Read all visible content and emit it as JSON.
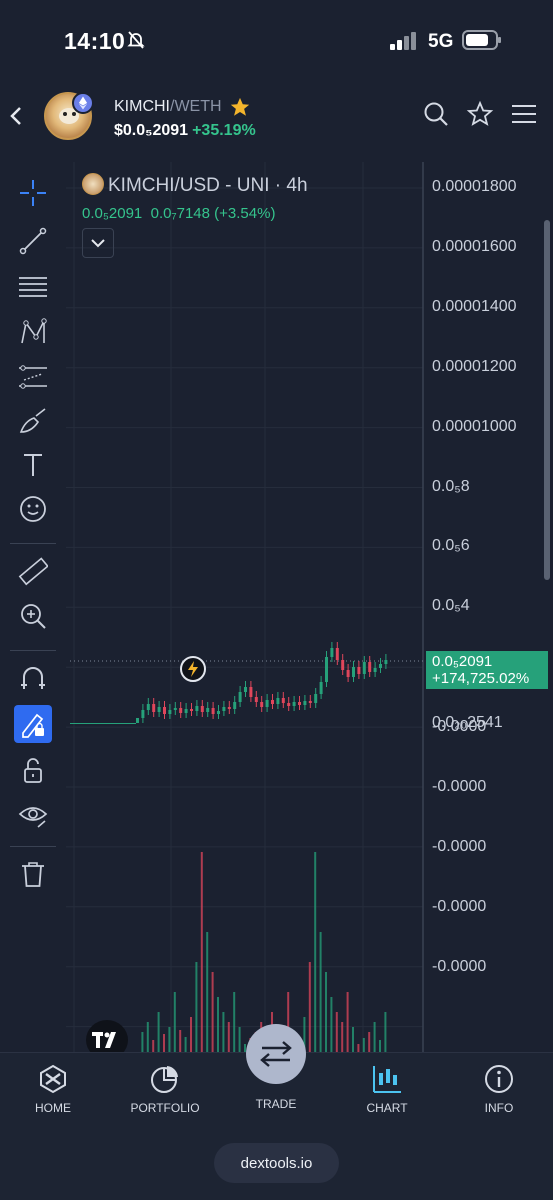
{
  "status_bar": {
    "time": "14:10",
    "network": "5G"
  },
  "header": {
    "token": "KIMCHI",
    "separator": "/",
    "quote": "WETH",
    "price": "$0.0₅2091",
    "change": "+35.19%"
  },
  "chart": {
    "title": "KIMCHI/USD - UNI · 4h",
    "ohlc_price": "0.0₅2091",
    "ohlc_change": "0.0₇7148 (+3.54%)",
    "y_axis_labels": [
      "0.00001800",
      "0.00001600",
      "0.00001400",
      "0.00001200",
      "0.00001000",
      "0.0₅8",
      "0.0₅6",
      "0.0₅4",
      "0.0₂₀2541",
      "-0.0000",
      "-0.0000",
      "-0.0000",
      "-0.0000",
      "-0.0000"
    ],
    "price_tag_value": "0.0₅2091",
    "price_tag_change": "+174,725.02%",
    "colors": {
      "up": "#26a17a",
      "down": "#e0465b",
      "accent": "#2f6bf0"
    }
  },
  "toolbar": {
    "tools": [
      "crosshair-icon",
      "trend-line-icon",
      "fib-icon",
      "pattern-icon",
      "forecast-icon",
      "brush-icon",
      "text-icon",
      "emoji-icon",
      "ruler-icon",
      "zoom-in-icon",
      "magnet-icon",
      "lock-drawing-icon",
      "unlock-icon",
      "eye-icon",
      "trash-icon"
    ]
  },
  "bottom_nav": {
    "items": [
      {
        "label": "HOME",
        "icon": "home-icon"
      },
      {
        "label": "PORTFOLIO",
        "icon": "portfolio-icon"
      },
      {
        "label": "TRADE",
        "icon": "swap-icon"
      },
      {
        "label": "CHART",
        "icon": "chart-icon"
      },
      {
        "label": "INFO",
        "icon": "info-icon"
      }
    ],
    "site": "dextools.io"
  }
}
